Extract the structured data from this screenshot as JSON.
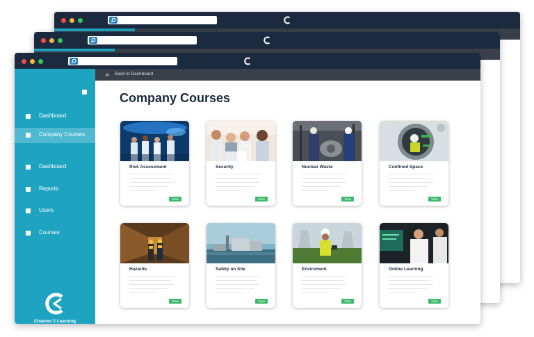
{
  "app": {
    "brand_name": "Channel 2 Learning",
    "accent_color": "#1ea4c1",
    "dark_color": "#1b2a3f",
    "button_color": "#3cb96b"
  },
  "topbar": {
    "back_icon": "«",
    "back_label": "Back to Dashboard"
  },
  "sidebar": {
    "items": [
      {
        "label": "Dashboard",
        "active": false
      },
      {
        "label": "Company Courses",
        "active": true
      },
      {
        "label": "Dashboard",
        "active": false
      },
      {
        "label": "Reports",
        "active": false
      },
      {
        "label": "Users",
        "active": false
      },
      {
        "label": "Courses",
        "active": false
      }
    ]
  },
  "main": {
    "title": "Company Courses",
    "courses": [
      {
        "name": "Risk Assessment",
        "button": "View",
        "image": "lab-researchers-photo"
      },
      {
        "name": "Security",
        "button": "View",
        "image": "group-meeting-photo"
      },
      {
        "name": "Nuclear Waste",
        "button": "View",
        "image": "industrial-workers-photo"
      },
      {
        "name": "Confined Space",
        "button": "View",
        "image": "tunnel-worker-photo"
      },
      {
        "name": "Hazards",
        "button": "View",
        "image": "corridor-workers-photo"
      },
      {
        "name": "Safety on Site",
        "button": "View",
        "image": "power-plant-photo"
      },
      {
        "name": "Enviroment",
        "button": "View",
        "image": "field-engineer-photo"
      },
      {
        "name": "Online Learning",
        "button": "View",
        "image": "scientists-screen-photo"
      }
    ]
  }
}
